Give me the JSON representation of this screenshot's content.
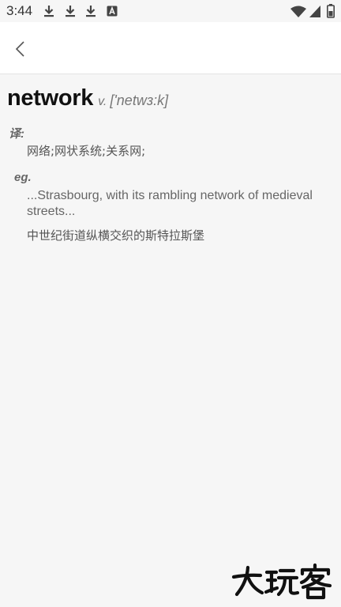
{
  "status_bar": {
    "time": "3:44",
    "notifications": [
      "download-icon",
      "download-icon",
      "download-icon",
      "font-app-icon"
    ],
    "system_icons": [
      "wifi-icon",
      "signal-icon",
      "battery-icon"
    ]
  },
  "app_bar": {
    "back_icon": "chevron-left-icon"
  },
  "entry": {
    "word": "network",
    "part_of_speech": "v.",
    "phonetic": "['netwɜ:k]",
    "translation_label": "译:",
    "translation": "网络;网状系统;关系网;",
    "example_label": "eg.",
    "example_en": "...Strasbourg, with its rambling network of medieval streets...",
    "example_zh": "中世纪街道纵横交织的斯特拉斯堡"
  },
  "watermark": {
    "text": "大玩客"
  },
  "colors": {
    "background": "#f6f6f6",
    "app_bar": "#ffffff",
    "headword": "#111111",
    "muted": "#777777"
  }
}
